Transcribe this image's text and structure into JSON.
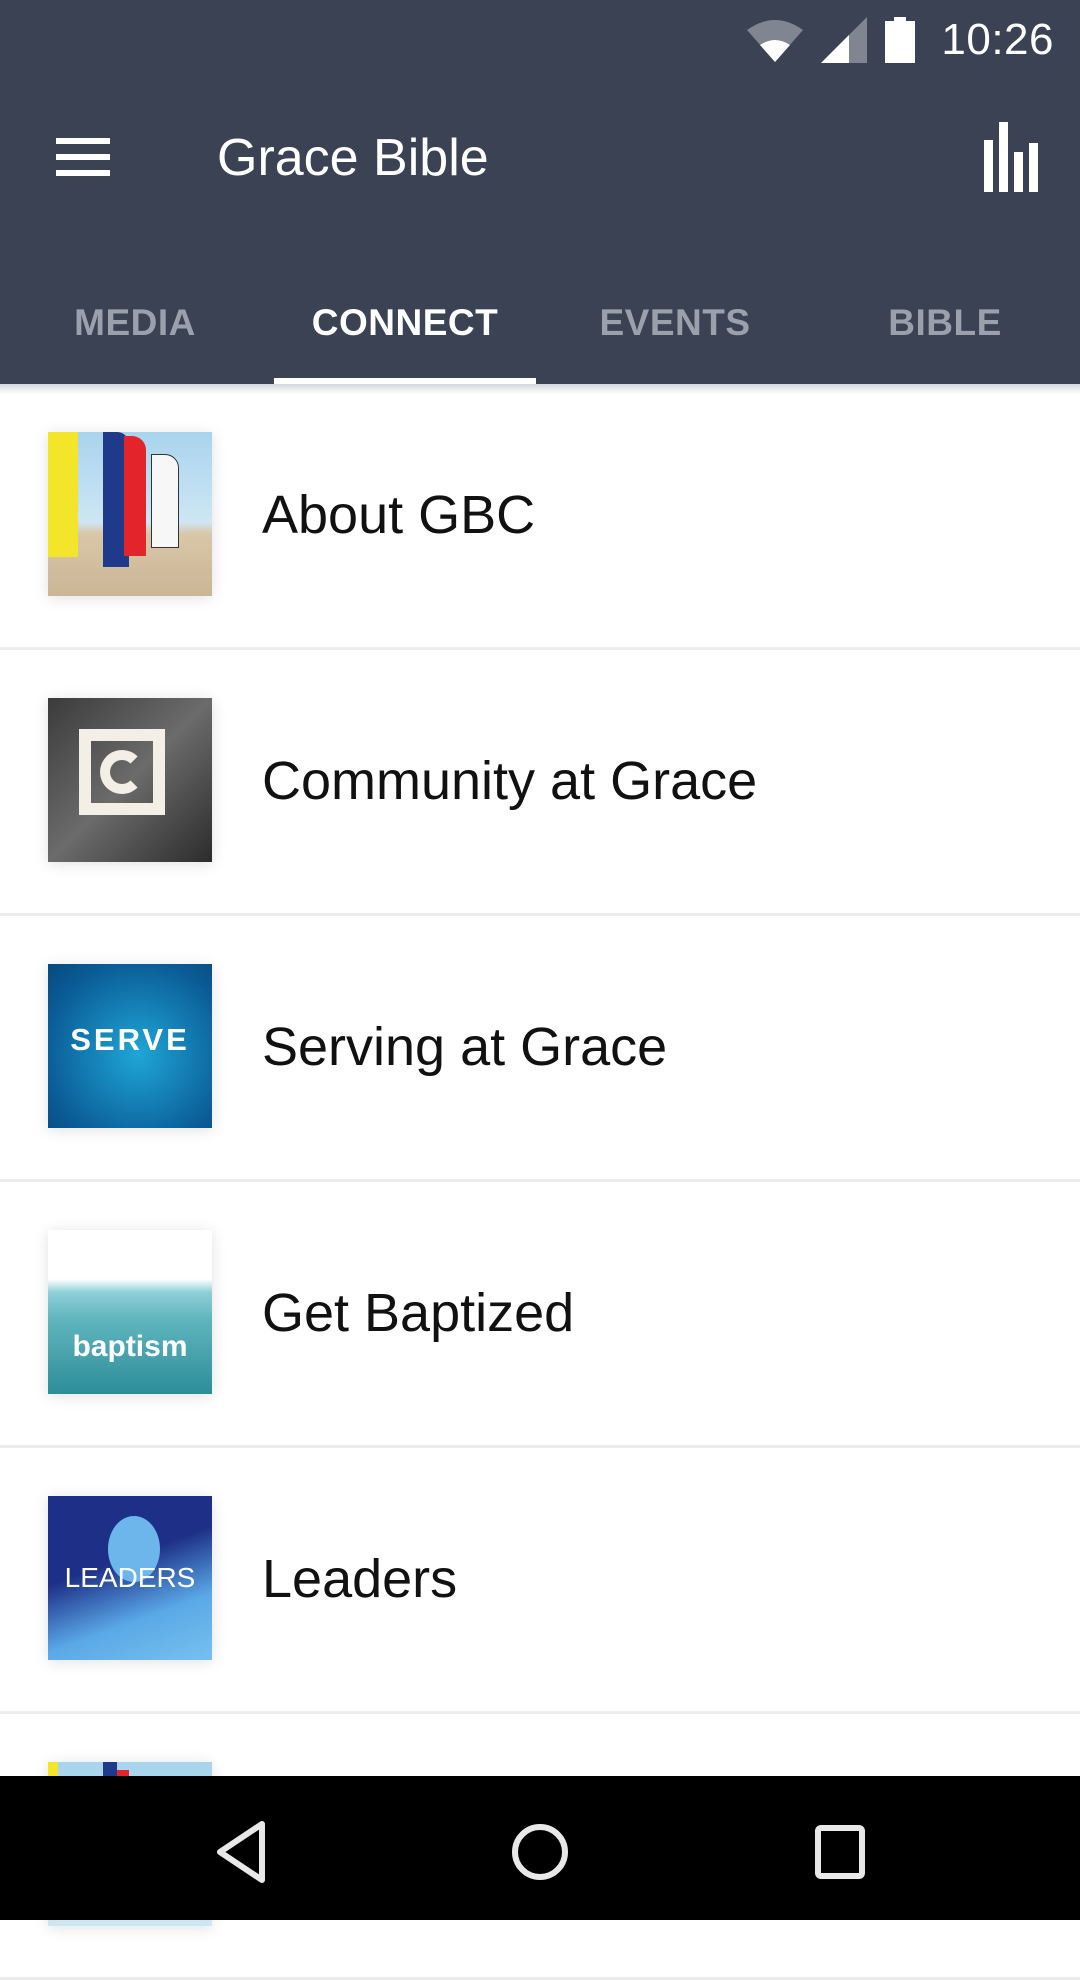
{
  "status_bar": {
    "time": "10:26",
    "icons": [
      "wifi-icon",
      "cell-signal-icon",
      "battery-icon"
    ]
  },
  "app_bar": {
    "menu_icon": "hamburger-menu-icon",
    "title": "Grace Bible",
    "action_icon": "bar-chart-icon"
  },
  "tabs": [
    {
      "label": "MEDIA",
      "active": false
    },
    {
      "label": "CONNECT",
      "active": true
    },
    {
      "label": "EVENTS",
      "active": false
    },
    {
      "label": "BIBLE",
      "active": false
    }
  ],
  "list": {
    "items": [
      {
        "label": "About GBC",
        "thumb_text": ""
      },
      {
        "label": "Community at Grace",
        "thumb_text": ""
      },
      {
        "label": "Serving at Grace",
        "thumb_text": "SERVE"
      },
      {
        "label": "Get Baptized",
        "thumb_text": "baptism"
      },
      {
        "label": "Leaders",
        "thumb_text": "LEADERS"
      }
    ]
  },
  "nav_bar": {
    "back": "back-icon",
    "home": "home-icon",
    "recents": "recents-icon"
  },
  "colors": {
    "app_bar": "#3a4253",
    "tab_inactive": "#9aa1ad",
    "tab_active": "#ffffff"
  }
}
